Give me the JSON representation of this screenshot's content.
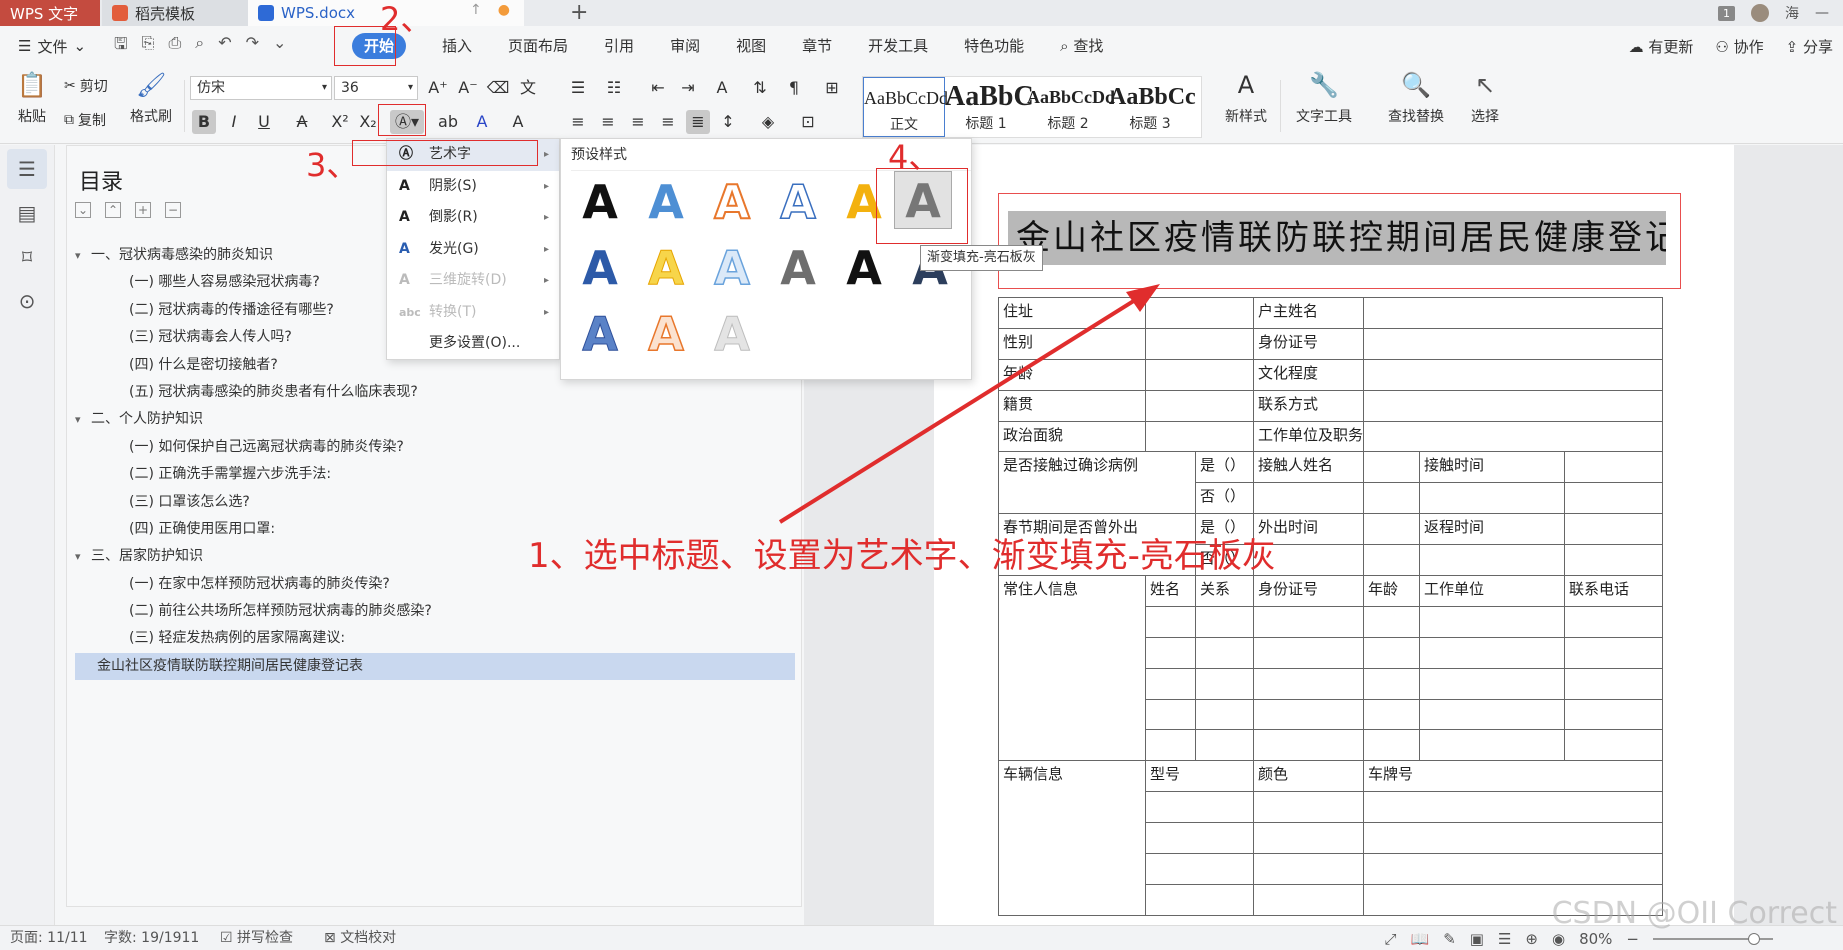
{
  "titlebar": {
    "app_tab": "WPS 文字",
    "template_tab": "稻壳模板",
    "doc_tab": "WPS.docx",
    "badge": "1",
    "user": "海"
  },
  "menubar": {
    "file": "文件",
    "tabs": [
      "开始",
      "插入",
      "页面布局",
      "引用",
      "审阅",
      "视图",
      "章节",
      "开发工具",
      "特色功能"
    ],
    "search": "查找",
    "update": "有更新",
    "collab": "协作",
    "share": "分享"
  },
  "ribbon": {
    "paste": "粘贴",
    "cut": "剪切",
    "copy": "复制",
    "format_painter": "格式刷",
    "font_name": "仿宋",
    "font_size": "36",
    "styles": [
      {
        "preview": "AaBbCcDd",
        "label": "正文"
      },
      {
        "preview": "AaBbC",
        "label": "标题 1"
      },
      {
        "preview": "AaBbCcDd",
        "label": "标题 2"
      },
      {
        "preview": "AaBbCc",
        "label": "标题 3"
      }
    ],
    "new_style": "新样式",
    "text_tools": "文字工具",
    "find_replace": "查找替换",
    "select": "选择"
  },
  "toc": {
    "title": "目录",
    "items": [
      {
        "level": 1,
        "text": "一、冠状病毒感染的肺炎知识"
      },
      {
        "level": 2,
        "text": "(一) 哪些人容易感染冠状病毒?"
      },
      {
        "level": 2,
        "text": "(二) 冠状病毒的传播途径有哪些?"
      },
      {
        "level": 2,
        "text": "(三) 冠状病毒会人传人吗?"
      },
      {
        "level": 2,
        "text": "(四) 什么是密切接触者?"
      },
      {
        "level": 2,
        "text": "(五) 冠状病毒感染的肺炎患者有什么临床表现?"
      },
      {
        "level": 1,
        "text": "二、个人防护知识"
      },
      {
        "level": 2,
        "text": "(一) 如何保护自己远离冠状病毒的肺炎传染?"
      },
      {
        "level": 2,
        "text": "(二) 正确洗手需掌握六步洗手法:"
      },
      {
        "level": 2,
        "text": "(三) 口罩该怎么选?"
      },
      {
        "level": 2,
        "text": "(四) 正确使用医用口罩:"
      },
      {
        "level": 1,
        "text": "三、居家防护知识"
      },
      {
        "level": 2,
        "text": "(一) 在家中怎样预防冠状病毒的肺炎传染?"
      },
      {
        "level": 2,
        "text": "(二) 前往公共场所怎样预防冠状病毒的肺炎感染?"
      },
      {
        "level": 2,
        "text": "(三) 轻症发热病例的居家隔离建议:"
      },
      {
        "level": 0,
        "text": "金山社区疫情联防联控期间居民健康登记表"
      }
    ]
  },
  "wordart_menu": {
    "items": [
      {
        "label": "艺术字",
        "arrow": true,
        "disabled": false
      },
      {
        "label": "阴影(S)",
        "arrow": true,
        "disabled": false
      },
      {
        "label": "倒影(R)",
        "arrow": true,
        "disabled": false
      },
      {
        "label": "发光(G)",
        "arrow": true,
        "disabled": false
      },
      {
        "label": "三维旋转(D)",
        "arrow": true,
        "disabled": true
      },
      {
        "label": "转换(T)",
        "arrow": true,
        "disabled": true
      },
      {
        "label": "更多设置(O)...",
        "arrow": false,
        "disabled": false
      }
    ],
    "preset_title": "预设样式",
    "tooltip": "渐变填充-亮石板灰"
  },
  "document": {
    "title": "金山社区疫情联防联控期间居民健康登记表",
    "table": {
      "address": "住址",
      "householder": "户主姓名",
      "gender": "性别",
      "id_no": "身份证号",
      "age": "年龄",
      "education": "文化程度",
      "origin": "籍贯",
      "contact": "联系方式",
      "politics": "政治面貌",
      "work_unit_duty": "工作单位及职务",
      "contact_case": "是否接触过确诊病例",
      "yes": "是（）",
      "no": "否（）",
      "contact_name": "接触人姓名",
      "contact_time": "接触时间",
      "spring_out": "春节期间是否曾外出",
      "out_time": "外出时间",
      "return_time": "返程时间",
      "resident_info": "常住人信息",
      "name": "姓名",
      "relation": "关系",
      "id_no2": "身份证号",
      "age2": "年龄",
      "work_unit": "工作单位",
      "phone": "联系电话",
      "vehicle_info": "车辆信息",
      "model": "型号",
      "color": "颜色",
      "plate": "车牌号"
    }
  },
  "annotations": {
    "step1": "1、选中标题、设置为艺术字、渐变填充-亮石板灰",
    "step2": "2、",
    "step3": "3、",
    "step4": "4、"
  },
  "statusbar": {
    "page": "页面: 11/11",
    "words": "字数: 19/1911",
    "spell": "拼写检查",
    "proof": "文档校对",
    "zoom": "80%",
    "watermark": "CSDN @OII Correct"
  }
}
